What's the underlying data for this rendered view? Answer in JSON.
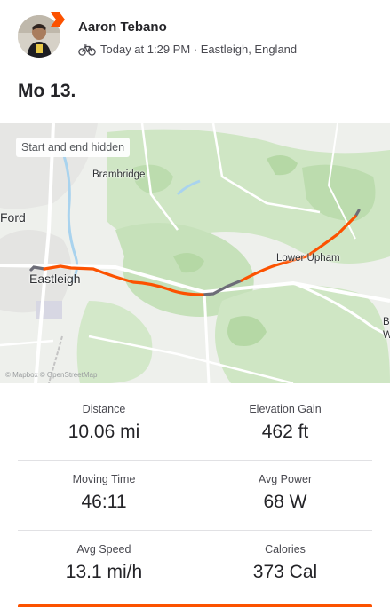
{
  "athlete": {
    "name": "Aaron Tebano",
    "activity_icon": "bike-icon",
    "meta": "Today at 1:29 PM · Eastleigh, England"
  },
  "activity": {
    "title": "Mo 13."
  },
  "map": {
    "privacy_label": "Start and end hidden",
    "places": {
      "brambridge": "Brambridge",
      "ford": "Ford",
      "eastleigh": "Eastleigh",
      "lower_upham": "Lower Upham",
      "edge_b": "B",
      "edge_w": "W"
    },
    "attribution": "© Mapbox © OpenStreetMap",
    "route_color": "#fc5200",
    "hidden_segment_color": "#6d6d78"
  },
  "stats": {
    "distance": {
      "label": "Distance",
      "value": "10.06 mi"
    },
    "elevation": {
      "label": "Elevation Gain",
      "value": "462 ft"
    },
    "moving_time": {
      "label": "Moving Time",
      "value": "46:11"
    },
    "avg_power": {
      "label": "Avg Power",
      "value": "68 W"
    },
    "avg_speed": {
      "label": "Avg Speed",
      "value": "13.1 mi/h"
    },
    "calories": {
      "label": "Calories",
      "value": "373 Cal"
    }
  },
  "colors": {
    "accent": "#fc5200",
    "text": "#242428"
  }
}
